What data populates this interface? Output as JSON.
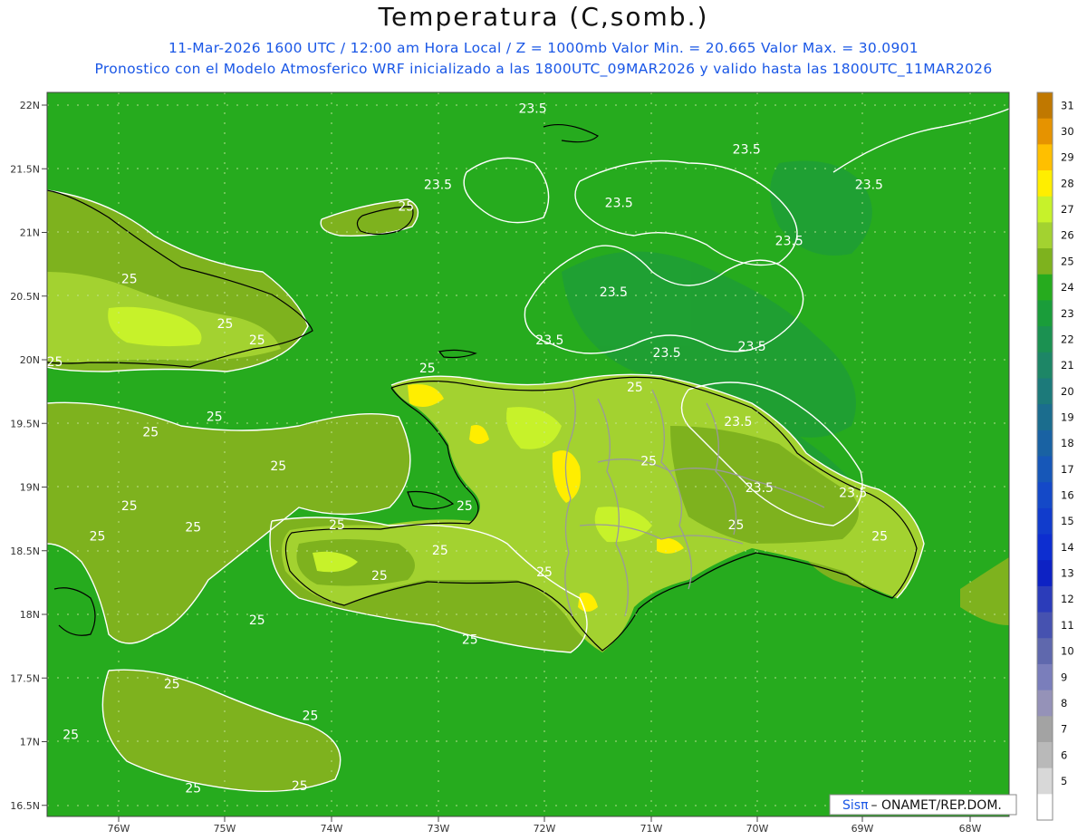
{
  "header": {
    "title": "Temperatura (C,somb.)",
    "subtitle_line1": "11-Mar-2026 1600 UTC / 12:00 am Hora Local / Z = 1000mb   Valor Min. = 20.665  Valor Max. = 30.0901",
    "subtitle_line2": "Pronostico con el Modelo Atmosferico WRF inicializado a las 1800UTC_09MAR2026 y valido hasta las  1800UTC_11MAR2026"
  },
  "map": {
    "lat_labels": [
      "22N",
      "21.5N",
      "21N",
      "20.5N",
      "20N",
      "19.5N",
      "19N",
      "18.5N",
      "18N",
      "17.5N",
      "17N",
      "16.5N"
    ],
    "lon_labels": [
      "76W",
      "75W",
      "74W",
      "73W",
      "72W",
      "71W",
      "70W",
      "69W",
      "68W"
    ],
    "contour_labels": [
      {
        "text": "23.5",
        "lon": -72.11,
        "lat": 21.94
      },
      {
        "text": "23.5",
        "lon": -70.1,
        "lat": 21.62
      },
      {
        "text": "23.5",
        "lon": -73.0,
        "lat": 21.34
      },
      {
        "text": "23.5",
        "lon": -71.3,
        "lat": 21.2
      },
      {
        "text": "23.5",
        "lon": -68.95,
        "lat": 21.34
      },
      {
        "text": "23.5",
        "lon": -69.7,
        "lat": 20.9
      },
      {
        "text": "23.5",
        "lon": -71.35,
        "lat": 20.5
      },
      {
        "text": "23.5",
        "lon": -71.95,
        "lat": 20.12
      },
      {
        "text": "23.5",
        "lon": -70.85,
        "lat": 20.02
      },
      {
        "text": "23.5",
        "lon": -70.05,
        "lat": 20.07
      },
      {
        "text": "23.5",
        "lon": -70.18,
        "lat": 19.48
      },
      {
        "text": "23.5",
        "lon": -69.98,
        "lat": 18.96
      },
      {
        "text": "23.5",
        "lon": -69.1,
        "lat": 18.92
      },
      {
        "text": "25",
        "lon": -73.3,
        "lat": 21.17
      },
      {
        "text": "25",
        "lon": -75.9,
        "lat": 20.6
      },
      {
        "text": "25",
        "lon": -75.0,
        "lat": 20.25
      },
      {
        "text": "25",
        "lon": -74.7,
        "lat": 20.12
      },
      {
        "text": "25",
        "lon": -76.6,
        "lat": 19.95
      },
      {
        "text": "25",
        "lon": -73.1,
        "lat": 19.9
      },
      {
        "text": "25",
        "lon": -71.15,
        "lat": 19.75
      },
      {
        "text": "25",
        "lon": -75.1,
        "lat": 19.52
      },
      {
        "text": "25",
        "lon": -75.7,
        "lat": 19.4
      },
      {
        "text": "25",
        "lon": -74.5,
        "lat": 19.13
      },
      {
        "text": "25",
        "lon": -71.02,
        "lat": 19.17
      },
      {
        "text": "25",
        "lon": -75.9,
        "lat": 18.82
      },
      {
        "text": "25",
        "lon": -75.3,
        "lat": 18.65
      },
      {
        "text": "25",
        "lon": -76.2,
        "lat": 18.58
      },
      {
        "text": "25",
        "lon": -73.95,
        "lat": 18.67
      },
      {
        "text": "25",
        "lon": -72.75,
        "lat": 18.82
      },
      {
        "text": "25",
        "lon": -70.2,
        "lat": 18.67
      },
      {
        "text": "25",
        "lon": -72.98,
        "lat": 18.47
      },
      {
        "text": "25",
        "lon": -68.85,
        "lat": 18.58
      },
      {
        "text": "25",
        "lon": -73.55,
        "lat": 18.27
      },
      {
        "text": "25",
        "lon": -72.0,
        "lat": 18.3
      },
      {
        "text": "25",
        "lon": -74.7,
        "lat": 17.92
      },
      {
        "text": "25",
        "lon": -72.7,
        "lat": 17.77
      },
      {
        "text": "25",
        "lon": -75.5,
        "lat": 17.42
      },
      {
        "text": "25",
        "lon": -74.2,
        "lat": 17.17
      },
      {
        "text": "25",
        "lon": -76.45,
        "lat": 17.02
      },
      {
        "text": "25",
        "lon": -75.3,
        "lat": 16.6
      },
      {
        "text": "25",
        "lon": -74.3,
        "lat": 16.62
      }
    ],
    "credit": {
      "sis": "Sis",
      "pi": "π",
      "rest": "– ONAMET/REP.DOM."
    }
  },
  "colorbar": {
    "levels": [
      {
        "label": "31",
        "color": "#c07800"
      },
      {
        "label": "30",
        "color": "#e69300"
      },
      {
        "label": "29",
        "color": "#ffbf00"
      },
      {
        "label": "28",
        "color": "#ffee00"
      },
      {
        "label": "27",
        "color": "#c7f22a"
      },
      {
        "label": "26",
        "color": "#a3d230"
      },
      {
        "label": "25",
        "color": "#7eb21e"
      },
      {
        "label": "24",
        "color": "#26ab1e"
      },
      {
        "label": "23",
        "color": "#1a9d3a"
      },
      {
        "label": "22",
        "color": "#1b9151"
      },
      {
        "label": "21",
        "color": "#1d8666"
      },
      {
        "label": "20",
        "color": "#1c7a7a"
      },
      {
        "label": "19",
        "color": "#1b6d8e"
      },
      {
        "label": "18",
        "color": "#1962a3"
      },
      {
        "label": "17",
        "color": "#1657b8"
      },
      {
        "label": "16",
        "color": "#1449c8"
      },
      {
        "label": "15",
        "color": "#113ccc"
      },
      {
        "label": "14",
        "color": "#0d2ed0"
      },
      {
        "label": "13",
        "color": "#0d22c4"
      },
      {
        "label": "12",
        "color": "#2b3cba"
      },
      {
        "label": "11",
        "color": "#4652b0"
      },
      {
        "label": "10",
        "color": "#5f68ad"
      },
      {
        "label": "9",
        "color": "#7a7ebb"
      },
      {
        "label": "8",
        "color": "#9592b8"
      },
      {
        "label": "7",
        "color": "#a3a3a3"
      },
      {
        "label": "6",
        "color": "#b9b9b9"
      },
      {
        "label": "5",
        "color": "#d8d8d8"
      },
      {
        "label": "",
        "color": "#ffffff"
      }
    ]
  },
  "colors": {
    "sea_green": "#26ab1e",
    "land_olive": "#7eb21e",
    "contour": "#ffffff",
    "coast": "#000000",
    "border": "#9a9a9a",
    "subtitle": "#1a57e6"
  }
}
